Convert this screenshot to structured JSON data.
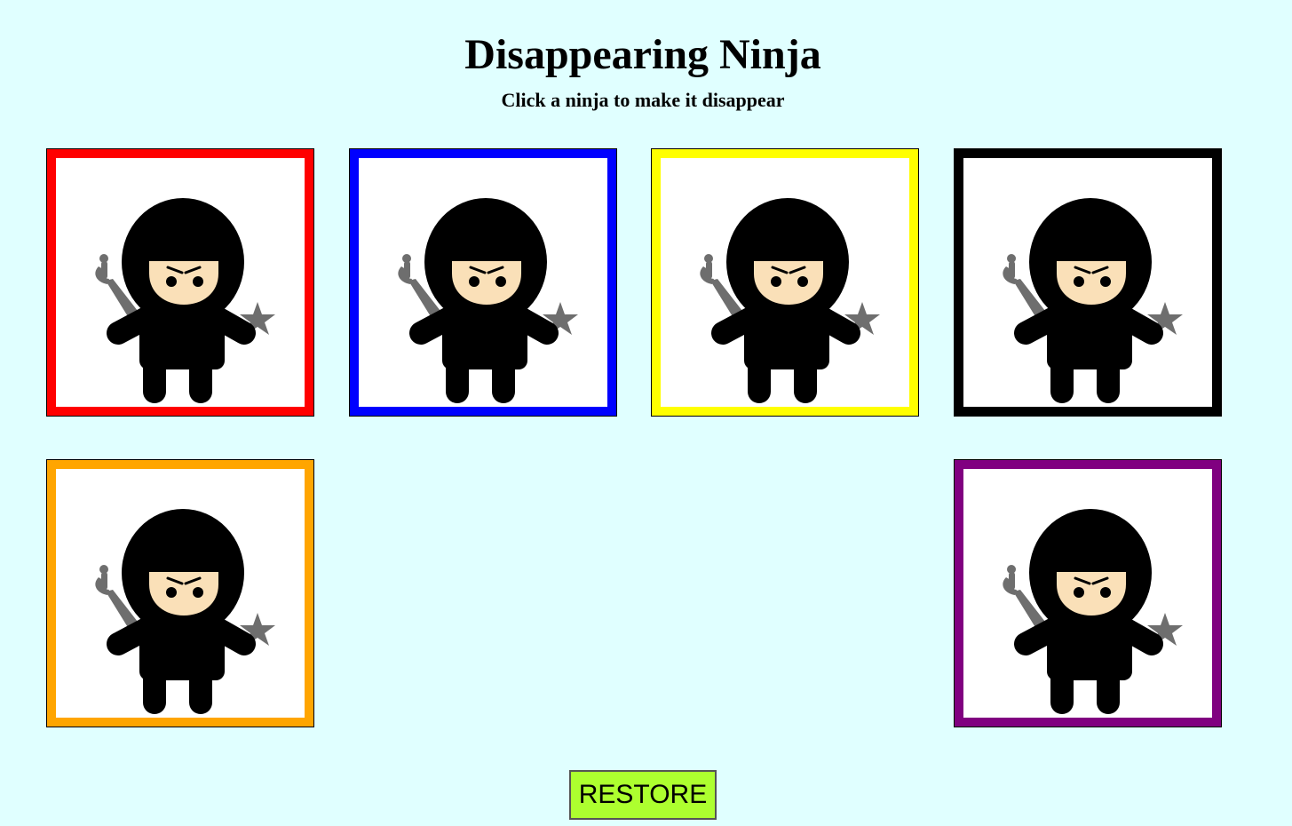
{
  "header": {
    "title": "Disappearing Ninja",
    "subtitle": "Click a ninja to make it disappear"
  },
  "ninjas": [
    {
      "color": "#ff0000",
      "name": "ninja-card-red",
      "visible": true
    },
    {
      "color": "#0000ff",
      "name": "ninja-card-blue",
      "visible": true
    },
    {
      "color": "#ffff00",
      "name": "ninja-card-yellow",
      "visible": true
    },
    {
      "color": "#000000",
      "name": "ninja-card-black",
      "visible": true
    },
    {
      "color": "#ffa500",
      "name": "ninja-card-orange",
      "visible": true
    },
    {
      "color": "#00ff00",
      "name": "ninja-card-green",
      "visible": false
    },
    {
      "color": "#0000ff",
      "name": "ninja-card-hidden",
      "visible": false
    },
    {
      "color": "#800080",
      "name": "ninja-card-purple",
      "visible": true
    }
  ],
  "restore": {
    "label": "RESTORE",
    "color": "#adff2f"
  },
  "background": "#e0ffff"
}
